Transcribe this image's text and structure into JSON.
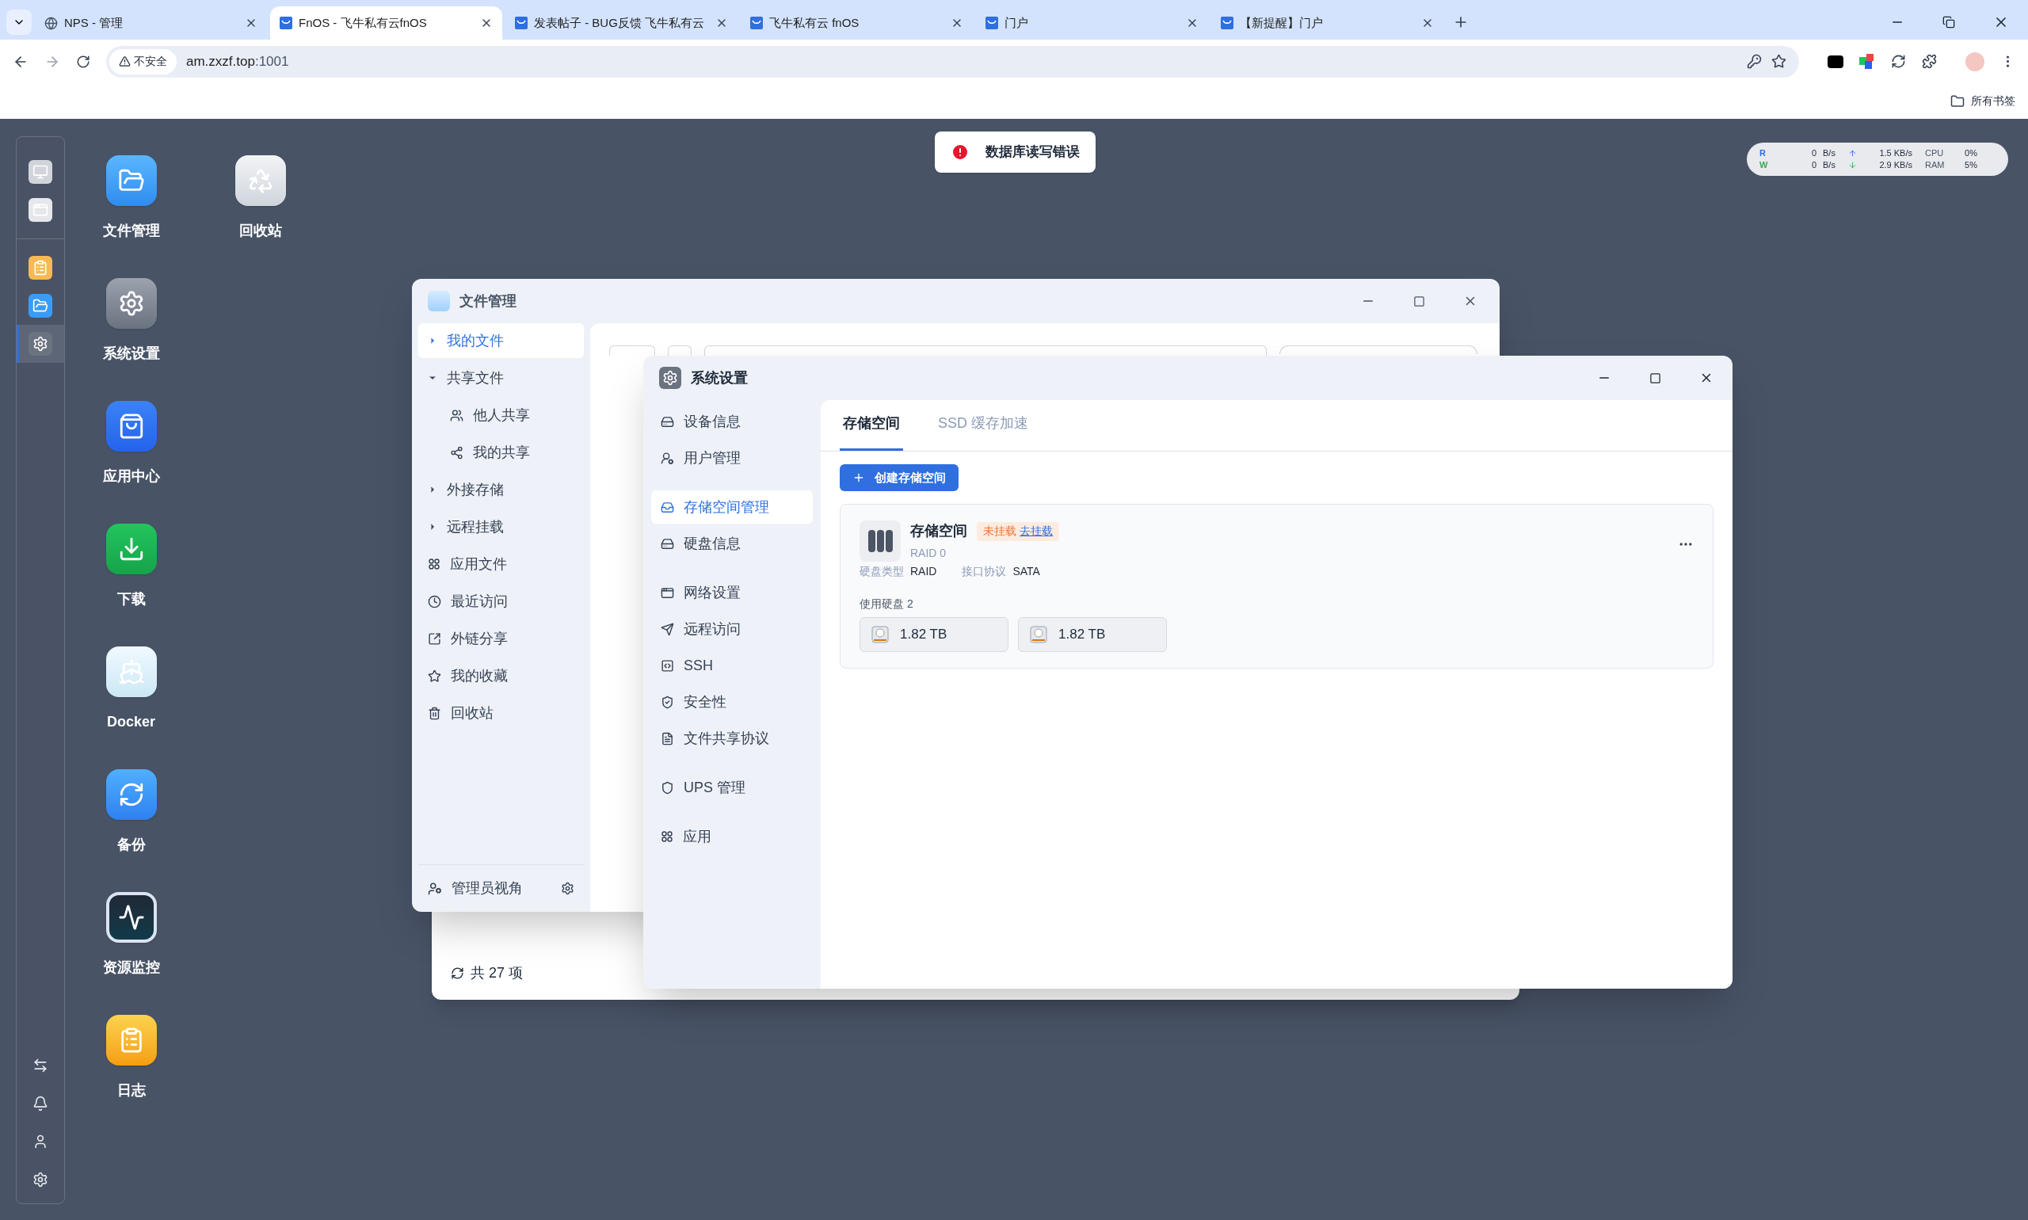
{
  "browser": {
    "tabs": [
      {
        "title": "NPS - 管理",
        "kind": "globe",
        "selected": false
      },
      {
        "title": "FnOS - 飞牛私有云fnOS",
        "kind": "app",
        "selected": true
      },
      {
        "title": "发表帖子 - BUG反馈 飞牛私有云",
        "kind": "app",
        "selected": false
      },
      {
        "title": "飞牛私有云 fnOS",
        "kind": "app",
        "selected": false
      },
      {
        "title": "门户",
        "kind": "app",
        "selected": false
      },
      {
        "title": "【新提醒】门户",
        "kind": "app",
        "selected": false
      }
    ],
    "security": "不安全",
    "host": "am.zxzf.top",
    "port": ":1001",
    "bookmarks": "所有书签"
  },
  "toast": {
    "message": "数据库读写错误"
  },
  "stats": [
    {
      "label": "R",
      "color": "#2f6fe0",
      "rate": "0",
      "unit": "B/s",
      "net": "1.5 KB/s",
      "metric": "CPU",
      "value": "0%"
    },
    {
      "label": "W",
      "color": "#3aa757",
      "rate": "0",
      "unit": "B/s",
      "net": "2.9 KB/s",
      "metric": "RAM",
      "value": "5%"
    }
  ],
  "dock": {
    "top": [
      {
        "selected": false
      },
      {
        "selected": false
      }
    ],
    "apps": [
      {
        "selected": false
      },
      {
        "selected": false
      },
      {
        "selected": true
      }
    ]
  },
  "desktop_icons": [
    {
      "label": "文件管理",
      "kind": "files"
    },
    {
      "label": "系统设置",
      "kind": "settings"
    },
    {
      "label": "应用中心",
      "kind": "store"
    },
    {
      "label": "下载",
      "kind": "download"
    },
    {
      "label": "Docker",
      "kind": "docker"
    },
    {
      "label": "备份",
      "kind": "backup"
    },
    {
      "label": "资源监控",
      "kind": "monitor"
    },
    {
      "label": "日志",
      "kind": "log"
    },
    {
      "label": "回收站",
      "kind": "trash"
    }
  ],
  "file_manager": {
    "title": "文件管理",
    "nav": [
      {
        "label": "我的文件",
        "kind": "folder",
        "expanded": false,
        "selected": true
      },
      {
        "label": "共享文件",
        "kind": "folder",
        "expanded": true,
        "selected": false,
        "children": [
          {
            "label": "他人共享",
            "selected": false
          },
          {
            "label": "我的共享",
            "selected": false
          }
        ]
      },
      {
        "label": "外接存储",
        "kind": "folder",
        "expanded": false,
        "selected": false
      },
      {
        "label": "远程挂载",
        "kind": "folder",
        "expanded": false,
        "selected": false
      },
      {
        "label": "应用文件",
        "kind": "link",
        "selected": false
      },
      {
        "label": "最近访问",
        "kind": "link",
        "selected": false
      },
      {
        "label": "外链分享",
        "kind": "link",
        "selected": false
      },
      {
        "label": "我的收藏",
        "kind": "link",
        "selected": false
      },
      {
        "label": "回收站",
        "kind": "link",
        "selected": false
      }
    ],
    "footer": "管理员视角",
    "status": "共 27 项"
  },
  "settings": {
    "title": "系统设置",
    "nav": [
      [
        {
          "label": "设备信息",
          "selected": false
        },
        {
          "label": "用户管理",
          "selected": false
        }
      ],
      [
        {
          "label": "存储空间管理",
          "selected": true
        },
        {
          "label": "硬盘信息",
          "selected": false
        }
      ],
      [
        {
          "label": "网络设置",
          "selected": false
        },
        {
          "label": "远程访问",
          "selected": false
        },
        {
          "label": "SSH",
          "selected": false
        },
        {
          "label": "安全性",
          "selected": false
        },
        {
          "label": "文件共享协议",
          "selected": false
        }
      ],
      [
        {
          "label": "UPS 管理",
          "selected": false
        }
      ],
      [
        {
          "label": "应用",
          "selected": false
        }
      ]
    ],
    "tabs": [
      {
        "label": "存储空间",
        "selected": true
      },
      {
        "label": "SSD 缓存加速",
        "selected": false
      }
    ],
    "create_button": "创建存储空间",
    "pool": {
      "name": "存储空间",
      "status": "未挂载",
      "action": "去挂载",
      "subtitle": "RAID 0",
      "fields": [
        {
          "label": "硬盘类型",
          "value": "RAID"
        },
        {
          "label": "接口协议",
          "value": "SATA"
        }
      ],
      "disks_label": "使用硬盘 2",
      "disks": [
        {
          "size": "1.82 TB"
        },
        {
          "size": "1.82 TB"
        }
      ]
    }
  }
}
